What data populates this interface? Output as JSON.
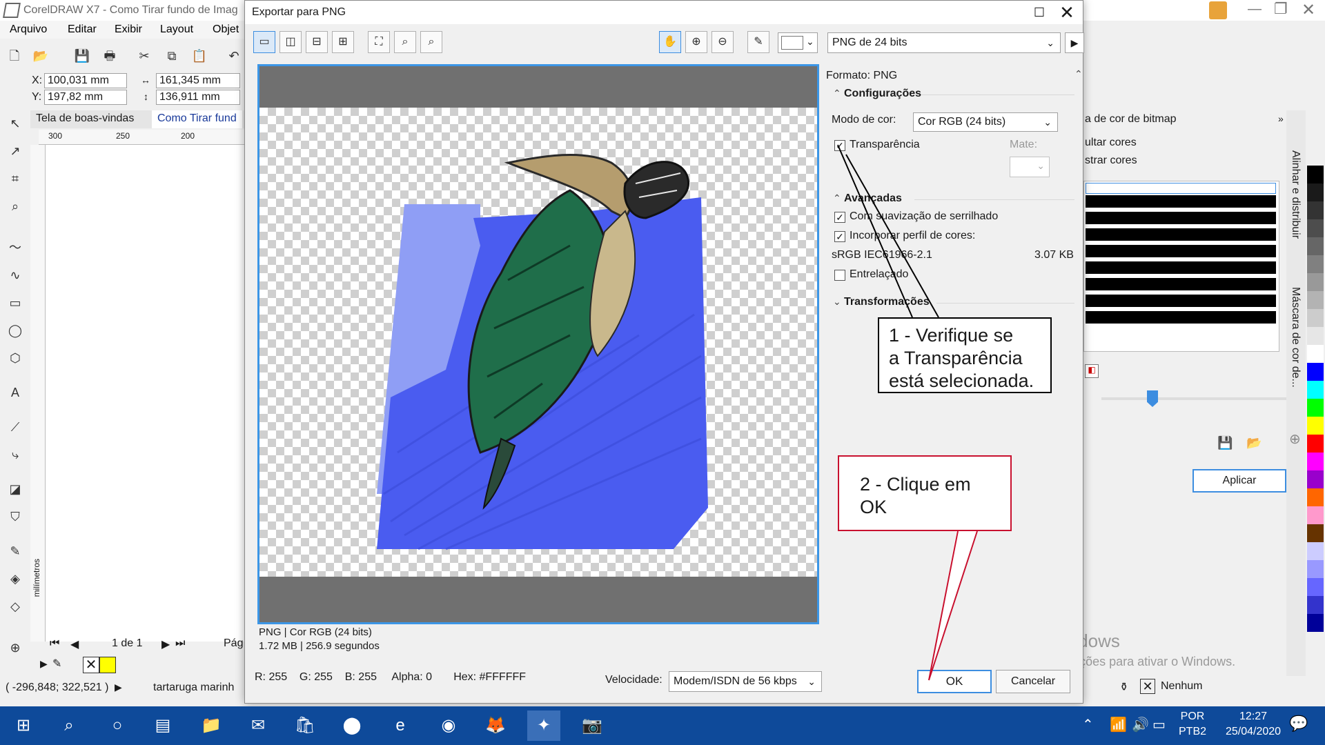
{
  "app": {
    "title": "CorelDRAW X7 - Como Tirar fundo de Imag",
    "menu": [
      "Arquivo",
      "Editar",
      "Exibir",
      "Layout",
      "Objet"
    ],
    "coords": {
      "x_label": "X:",
      "x": "100,031 mm",
      "y_label": "Y:",
      "y": "197,82 mm",
      "w": "161,345 mm",
      "h": "136,911 mm"
    },
    "doc_tabs": [
      "Tela de boas-vindas",
      "Como Tirar fund"
    ],
    "ruler_ticks": [
      "300",
      "250",
      "200"
    ],
    "ruler_v_label": "milímetros",
    "page_nav": {
      "page": "1 de 1",
      "page_label": "Pág"
    },
    "status": {
      "cursor": "( -296,848; 322,521 )",
      "object": "tartaruga marinh"
    },
    "fill_none": "Nenhum"
  },
  "docker": {
    "title": "a de cor de bitmap",
    "options": [
      "ultar cores",
      "strar cores"
    ],
    "apply_label": "Aplicar",
    "vtabs": [
      "Alinhar e distribuir",
      "Máscara de cor de..."
    ],
    "palette": [
      "#000000",
      "#1a1a1a",
      "#333333",
      "#4d4d4d",
      "#666666",
      "#808080",
      "#999999",
      "#b3b3b3",
      "#cccccc",
      "#e6e6e6",
      "#ffffff",
      "#0000ff",
      "#00ffff",
      "#00ff00",
      "#ffff00",
      "#ff0000",
      "#ff00ff",
      "#9900cc",
      "#ff6600",
      "#ff99cc",
      "#663300",
      "#ccccff",
      "#9999ff",
      "#6666ff",
      "#3333cc",
      "#000099"
    ]
  },
  "dialog": {
    "title": "Exportar para PNG",
    "format_select": "PNG de 24 bits",
    "format_label": "Formato: PNG",
    "sections": {
      "config": "Configurações",
      "advanced": "Avançadas",
      "transform": "Transformações"
    },
    "color_mode_label": "Modo de cor:",
    "color_mode_value": "Cor RGB (24 bits)",
    "transparency_label": "Transparência",
    "transparency_checked": true,
    "matte_label": "Mate:",
    "antialias_label": "Com suavização de serrilhado",
    "antialias_checked": true,
    "embed_profile_label": "Incorporar perfil de cores:",
    "embed_profile_checked": true,
    "profile_name": "sRGB IEC61966-2.1",
    "profile_size": "3.07 KB",
    "interlaced_label": "Entrelaçado",
    "interlaced_checked": false,
    "preview_info_line1": "PNG  |  Cor RGB (24 bits)",
    "preview_info_line2": "1.72 MB  |  256.9 segundos",
    "pixel_r": "R: 255",
    "pixel_g": "G: 255",
    "pixel_b": "B: 255",
    "pixel_alpha": "Alpha: 0",
    "pixel_hex": "Hex: #FFFFFF",
    "speed_label": "Velocidade:",
    "speed_value": "Modem/ISDN de 56 kbps",
    "ok_label": "OK",
    "cancel_label": "Cancelar"
  },
  "callouts": {
    "step1": "1 - Verifique se\na Transparência\nestá selecionada.",
    "step2": "2 - Clique em\n     OK"
  },
  "watermark": {
    "title": "Ativar o Windows",
    "subtitle": "Acesse Configurações para ativar o Windows."
  },
  "taskbar": {
    "lang1": "POR",
    "lang2": "PTB2",
    "time": "12:27",
    "date": "25/04/2020"
  },
  "colors": {
    "accent": "#3c96e6",
    "callout_red": "#c8102e",
    "taskbar": "#0e4a9a",
    "blue_fill": "#4a5cf0"
  }
}
